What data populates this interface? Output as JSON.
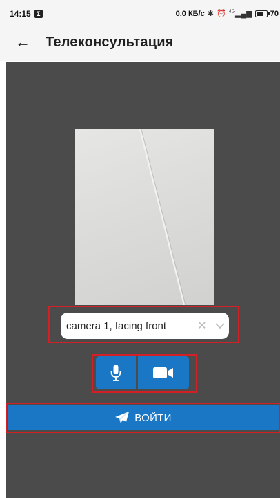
{
  "status_bar": {
    "time": "14:15",
    "notification_badge": "Σ",
    "network_speed": "0,0 КБ/с",
    "network_type": "4G",
    "battery": "70"
  },
  "app_bar": {
    "back_icon": "arrow-left-icon",
    "title": "Телеконсультация"
  },
  "camera_select": {
    "value": "camera 1, facing front",
    "clear_icon": "close-icon",
    "dropdown_icon": "chevron-down-icon"
  },
  "media_toggles": {
    "mic_icon": "microphone-icon",
    "camera_icon": "video-camera-icon"
  },
  "join_button": {
    "icon": "paper-plane-icon",
    "label": "ВОЙТИ"
  },
  "colors": {
    "primary": "#1977c6",
    "highlight": "#d32027",
    "content_bg": "#4b4b4b",
    "app_bar_bg": "#f5f5f5"
  }
}
